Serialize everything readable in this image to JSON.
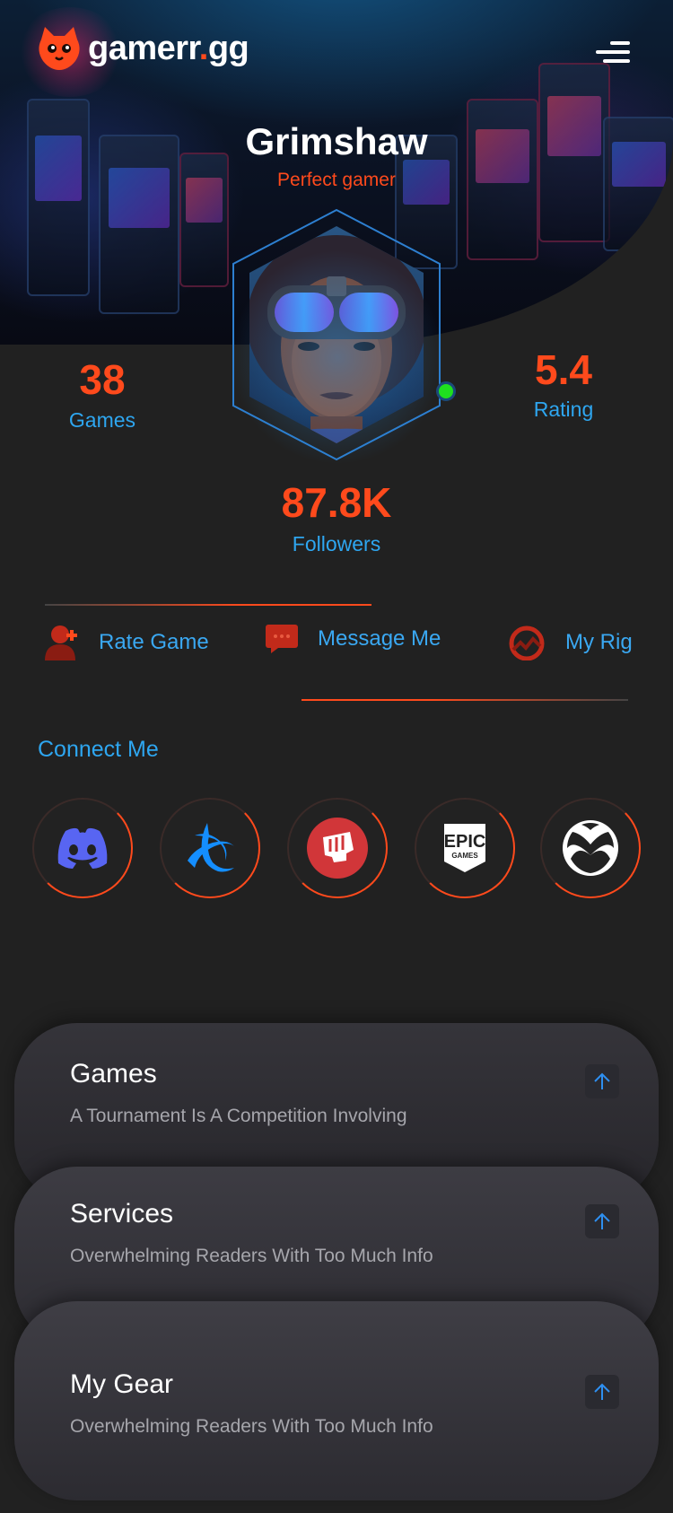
{
  "brand": {
    "name_main": "gamerr",
    "name_dot": ".",
    "name_tld": "gg"
  },
  "profile": {
    "name": "Grimshaw",
    "tagline": "Perfect gamer"
  },
  "stats": {
    "games": {
      "value": "38",
      "label": "Games"
    },
    "rating": {
      "value": "5.4",
      "label": "Rating"
    },
    "followers": {
      "value": "87.8K",
      "label": "Followers"
    }
  },
  "actions": [
    {
      "label": "Rate Game",
      "icon": "add-user-icon"
    },
    {
      "label": "Message Me",
      "icon": "chat-icon"
    },
    {
      "label": "My Rig",
      "icon": "gauge-icon"
    }
  ],
  "connect": {
    "title": "Connect Me",
    "platforms": [
      "discord-icon",
      "battlenet-icon",
      "riot-icon",
      "epic-games-icon",
      "xbox-icon"
    ],
    "epic_logo_text": [
      "EPIC",
      "GAMES"
    ]
  },
  "cards": [
    {
      "title": "Games",
      "description": "A Tournament Is A Competition Involving"
    },
    {
      "title": "Services",
      "description": "Overwhelming Readers With Too Much Info"
    },
    {
      "title": "My Gear",
      "description": "Overwhelming Readers With Too Much Info"
    }
  ],
  "colors": {
    "accent": "#ff4a1c",
    "link": "#2ea6f0",
    "background": "#212121",
    "online": "#1fe01f"
  }
}
